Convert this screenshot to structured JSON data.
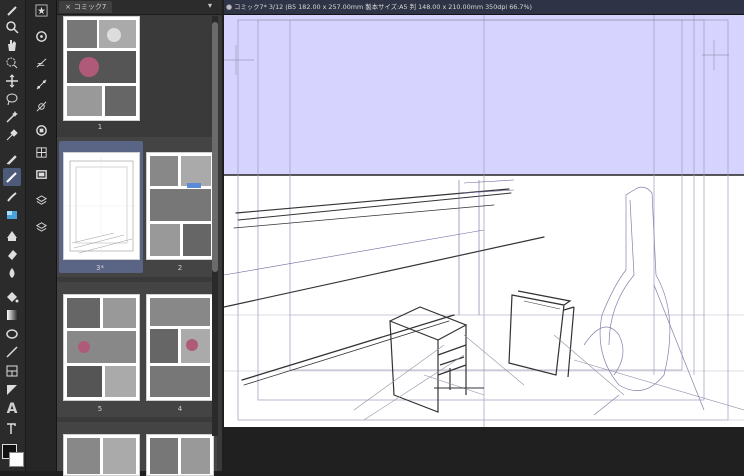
{
  "panel": {
    "tab_label": "コミック7",
    "pages": [
      {
        "label": "1"
      },
      {
        "label": "3*"
      },
      {
        "label": "2"
      },
      {
        "label": "5"
      },
      {
        "label": "4"
      }
    ]
  },
  "canvas": {
    "tab_title": "コミック7* 3/12 (B5 182.00 x 257.00mm 製本サイズ:A5 判 148.00 x 210.00mm 350dpi 66.7%)"
  },
  "colors": {
    "selection_overlay": "#d6d4ff",
    "active_tool": "#4d5a7a",
    "foreground": "#111111",
    "background": "#ffffff"
  },
  "icons": {
    "tools": [
      "pen-tip-icon",
      "search-icon",
      "hand-icon",
      "lasso-select-icon",
      "move-icon",
      "lasso-icon",
      "magic-wand-icon",
      "eyedropper-icon",
      "pen-icon",
      "pencil-icon",
      "brush-icon",
      "airbrush-icon",
      "decoration-icon",
      "eraser-icon",
      "blend-icon",
      "fill-icon",
      "gradient-icon",
      "figure-icon",
      "balloon-icon",
      "line-icon",
      "frame-border-icon",
      "ruler-icon",
      "text-icon",
      "correct-line-icon"
    ],
    "subtools": [
      "star-icon",
      "rotate-icon",
      "filter-icon",
      "curve-icon",
      "ruler-curve-icon",
      "frame-icon",
      "grid-icon",
      "layer-icon",
      "stack-icon",
      "layers-icon"
    ]
  }
}
